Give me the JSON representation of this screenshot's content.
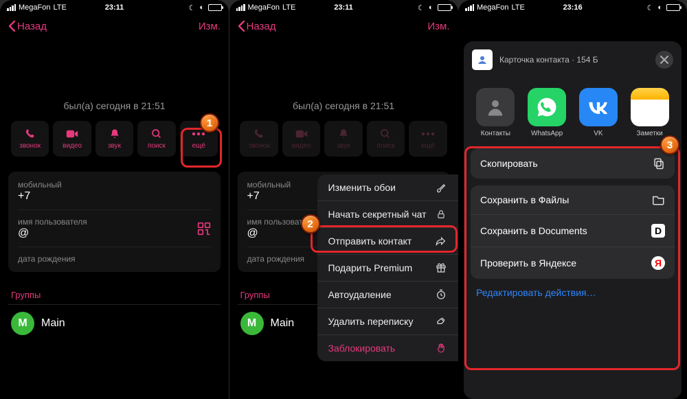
{
  "status": {
    "carrier": "MegaFon",
    "net": "LTE",
    "time1": "23:11",
    "time2": "23:11",
    "time3": "23:16"
  },
  "nav": {
    "back": "Назад",
    "edit": "Изм."
  },
  "presence": "был(а) сегодня в 21:51",
  "actions": {
    "call": "звонок",
    "video": "видео",
    "mute": "звук",
    "search": "поиск",
    "more": "ещё"
  },
  "info": {
    "mobile_label": "мобильный",
    "mobile_value": "+7",
    "username_label": "имя пользователя",
    "username_value": "@",
    "birthday_label": "дата рождения"
  },
  "groups": {
    "header": "Группы",
    "main": "Main",
    "initial": "M"
  },
  "ctx": {
    "wallpaper": "Изменить обои",
    "secret": "Начать секретный чат",
    "send_contact": "Отправить контакт",
    "gift_premium": "Подарить Premium",
    "autodelete": "Автоудаление",
    "delete_chat": "Удалить переписку",
    "block": "Заблокировать"
  },
  "sheet": {
    "title": "Карточка контакта · 154 Б",
    "apps": {
      "contacts": "Контакты",
      "whatsapp": "WhatsApp",
      "vk": "VK",
      "notes": "Заметки"
    },
    "copy": "Скопировать",
    "save_files": "Сохранить в Файлы",
    "save_docs": "Сохранить в Documents",
    "check_yandex": "Проверить в Яндексе",
    "edit_actions": "Редактировать действия…"
  },
  "markers": {
    "m1": "1",
    "m2": "2",
    "m3": "3"
  }
}
